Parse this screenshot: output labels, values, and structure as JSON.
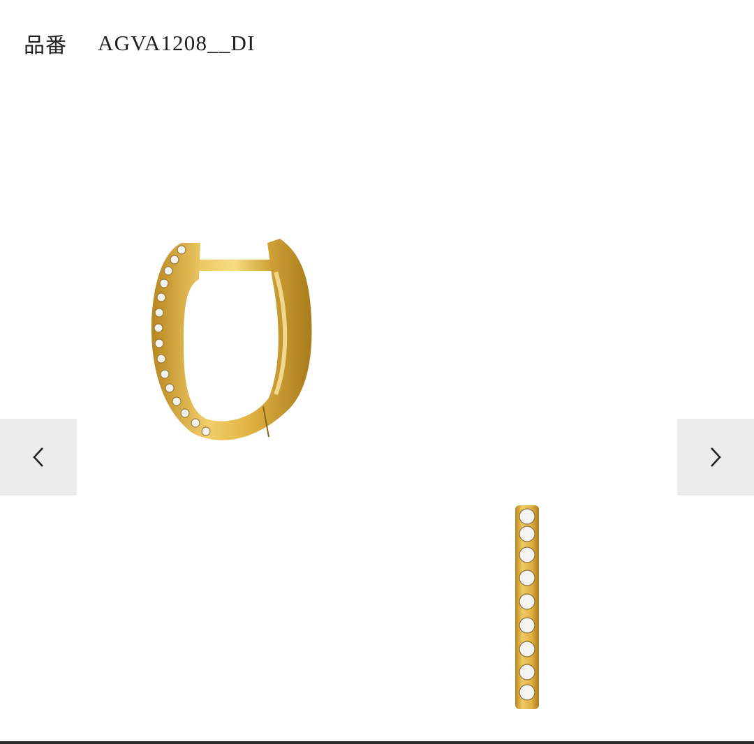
{
  "header": {
    "label": "品番",
    "product_code": "AGVA1208__DI"
  },
  "carousel": {
    "prev_icon": "chevron-left-icon",
    "next_icon": "chevron-right-icon"
  },
  "colors": {
    "gold": "#d9ad3c",
    "gold_dark": "#a87d1e",
    "gold_light": "#f4d678",
    "nav_bg": "#ececec",
    "text": "#1e1e1e"
  }
}
